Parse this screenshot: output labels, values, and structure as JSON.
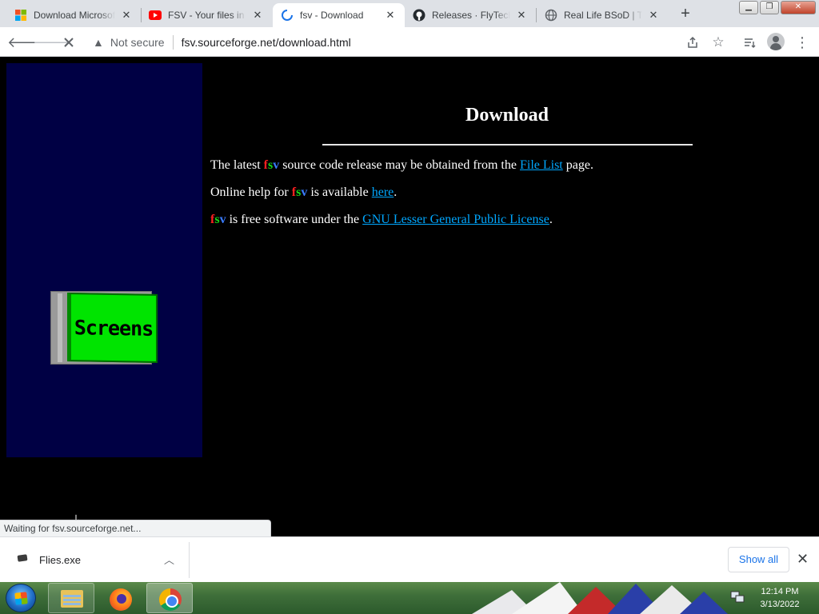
{
  "browser": {
    "tabs": [
      {
        "title": "Download Microsoft",
        "icon": "windows-logo-icon",
        "active": false
      },
      {
        "title": "FSV - Your files in 3D",
        "icon": "youtube-icon",
        "active": false
      },
      {
        "title": "fsv - Download",
        "icon": "loading-spinner-icon",
        "active": true
      },
      {
        "title": "Releases · FlyTechVideos",
        "icon": "github-icon",
        "active": false
      },
      {
        "title": "Real Life BSoD | The",
        "icon": "globe-icon",
        "active": false
      }
    ],
    "security_label": "Not secure",
    "url": "fsv.sourceforge.net/download.html"
  },
  "page": {
    "heading": "Download",
    "para1": {
      "before": "The latest ",
      "after": " source code release may be obtained from the ",
      "link": "File List",
      "end": " page."
    },
    "para2": {
      "before": "Online help for ",
      "after": " is available ",
      "link": "here",
      "end": "."
    },
    "para3": {
      "after": " is free software under the ",
      "link": "GNU Lesser General Public License",
      "end": "."
    },
    "logo": {
      "f": "f",
      "s": "s",
      "v": "v"
    },
    "screens_button": "Screens"
  },
  "status_text": "Waiting for fsv.sourceforge.net...",
  "downloads": {
    "file_name": "Flies.exe",
    "show_all": "Show all"
  },
  "taskbar": {
    "time": "12:14 PM",
    "date": "3/13/2022"
  },
  "colors": {
    "sidebar": "#000044",
    "link": "#00a7ff",
    "screens_green": "#00e400"
  }
}
